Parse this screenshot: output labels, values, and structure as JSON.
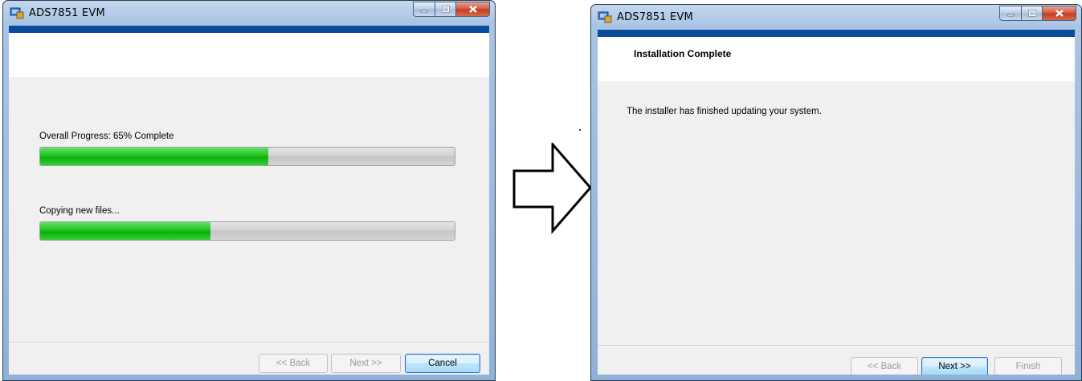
{
  "window_left": {
    "title": "ADS7851 EVM",
    "overall_label": "Overall Progress: 65% Complete",
    "overall_progress": 0.55,
    "status_text": "Copying new files...",
    "status_progress": 0.41,
    "buttons": {
      "back": "<< Back",
      "next": "Next >>",
      "cancel": "Cancel"
    }
  },
  "window_right": {
    "title": "ADS7851 EVM",
    "heading": "Installation Complete",
    "message": "The installer has finished updating your system.",
    "buttons": {
      "back": "<< Back",
      "next": "Next >>",
      "finish": "Finish"
    }
  },
  "icons": [
    "app-icon",
    "minimize-icon",
    "maximize-icon",
    "close-icon",
    "right-arrow-icon"
  ],
  "colors": {
    "accent_bar": "#0a4c9c",
    "progress_fill": "#1fc21f",
    "close_button": "#c23b1f"
  }
}
